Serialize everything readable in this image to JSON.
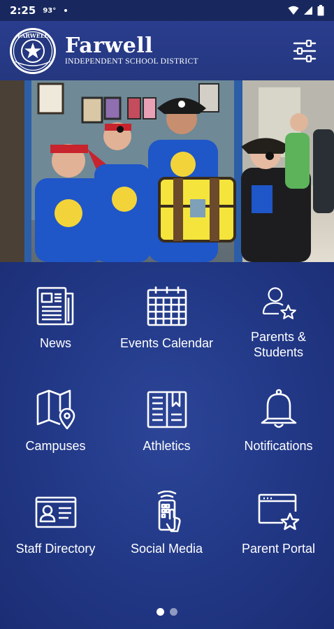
{
  "status_bar": {
    "time": "2:25",
    "temperature": "93°",
    "icons": [
      "wifi-icon",
      "signal-icon",
      "battery-icon"
    ]
  },
  "header": {
    "logo_text": "FARWELL",
    "title": "Farwell",
    "subtitle": "INDEPENDENT SCHOOL DISTRICT",
    "menu_icon": "sliders-menu-icon"
  },
  "hero": {
    "image": "photo of students in pirate costumes with a treasure chest"
  },
  "tiles": [
    {
      "label": "News",
      "icon": "newspaper-icon"
    },
    {
      "label": "Events Calendar",
      "icon": "calendar-icon"
    },
    {
      "label": "Parents & Students",
      "icon": "person-star-icon"
    },
    {
      "label": "Campuses",
      "icon": "map-pin-icon"
    },
    {
      "label": "Athletics",
      "icon": "book-bookmark-icon"
    },
    {
      "label": "Notifications",
      "icon": "bell-icon"
    },
    {
      "label": "Staff Directory",
      "icon": "id-card-icon"
    },
    {
      "label": "Social Media",
      "icon": "phone-tap-icon"
    },
    {
      "label": "Parent Portal",
      "icon": "browser-star-icon"
    }
  ],
  "pager": {
    "pages": 2,
    "current": 1
  },
  "colors": {
    "header": "#24377f",
    "background": "#1c2f78",
    "status_bar": "#18285f"
  }
}
